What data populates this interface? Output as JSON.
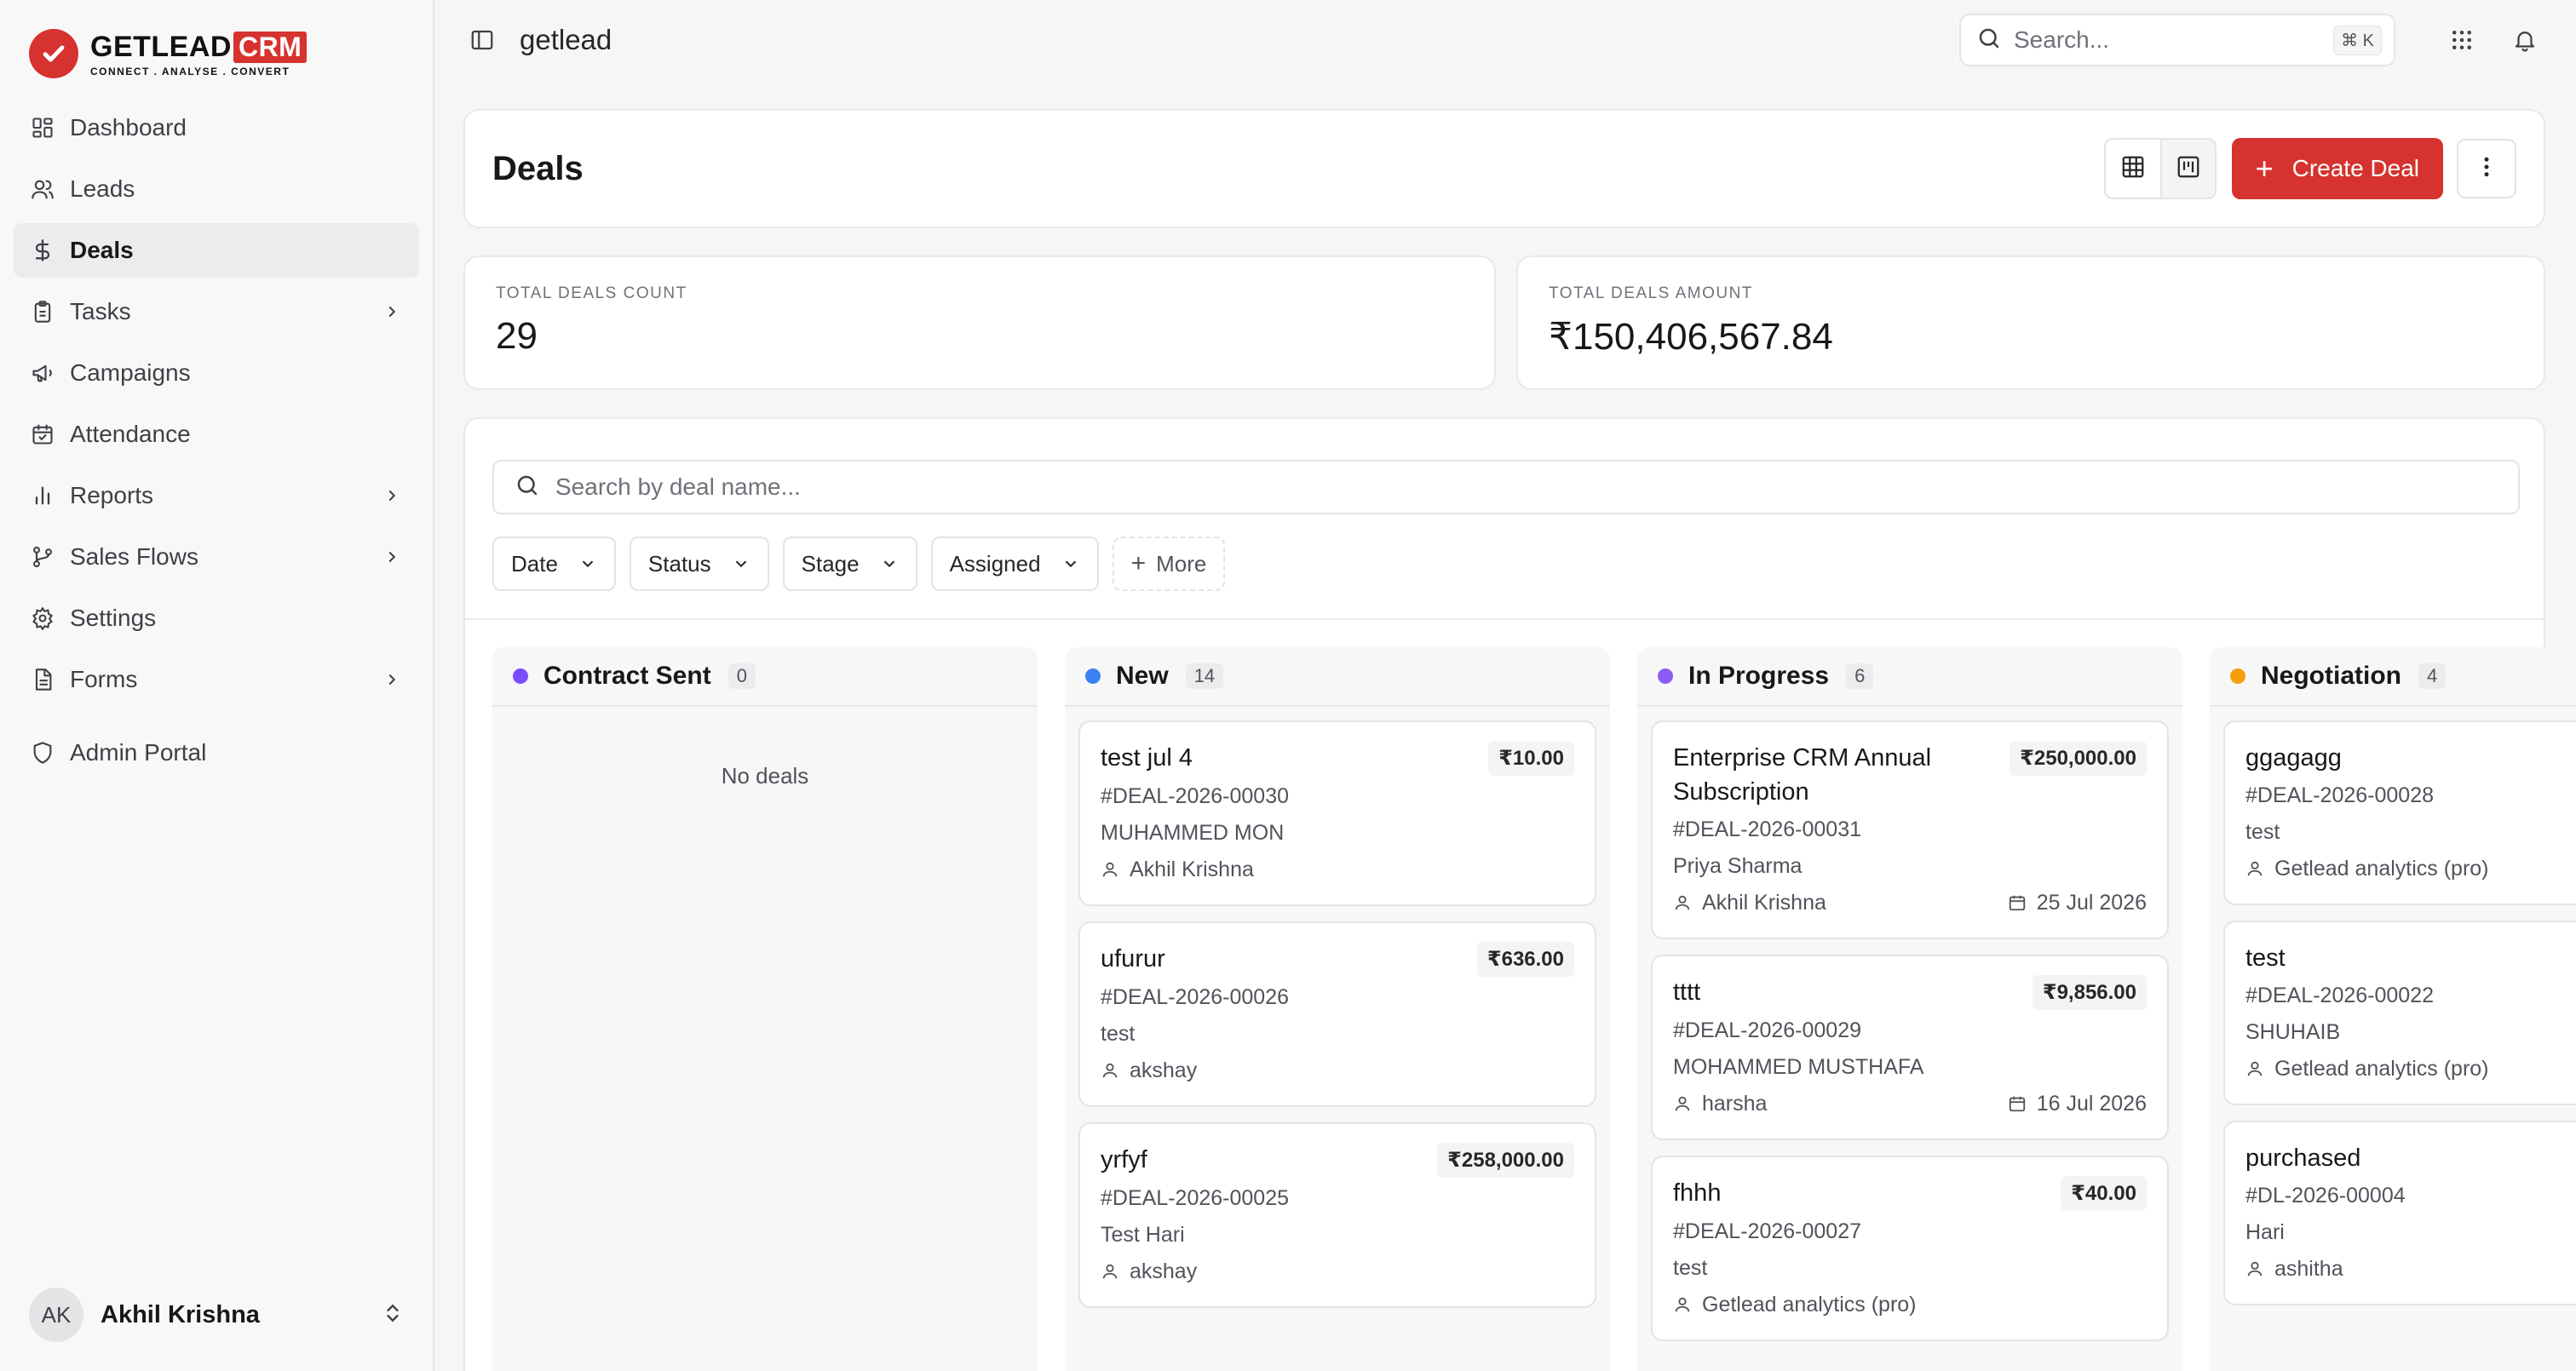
{
  "brand": {
    "name": "GETLEAD",
    "suffix": "CRM",
    "tagline": "CONNECT . ANALYSE . CONVERT"
  },
  "colors": {
    "accent": "#d6322f",
    "contract_sent": "#7c4dff",
    "new": "#3b82f6",
    "in_progress": "#8b5cf6",
    "negotiation": "#f59e0b"
  },
  "sidebar": {
    "items": [
      {
        "label": "Dashboard",
        "icon": "grid-icon"
      },
      {
        "label": "Leads",
        "icon": "users-icon"
      },
      {
        "label": "Deals",
        "icon": "dollar-icon",
        "active": true
      },
      {
        "label": "Tasks",
        "icon": "clipboard-icon",
        "has_children": true
      },
      {
        "label": "Campaigns",
        "icon": "megaphone-icon"
      },
      {
        "label": "Attendance",
        "icon": "calendar-check-icon"
      },
      {
        "label": "Reports",
        "icon": "bar-chart-icon",
        "has_children": true
      },
      {
        "label": "Sales Flows",
        "icon": "git-branch-icon",
        "has_children": true
      },
      {
        "label": "Settings",
        "icon": "gear-icon"
      },
      {
        "label": "Forms",
        "icon": "file-text-icon",
        "has_children": true
      },
      {
        "label": "Admin Portal",
        "icon": "shield-icon"
      }
    ],
    "user": {
      "initials": "AK",
      "name": "Akhil Krishna"
    }
  },
  "topbar": {
    "workspace": "getlead",
    "search_placeholder": "Search...",
    "shortcut": "⌘ K"
  },
  "page": {
    "title": "Deals",
    "create_label": "Create Deal",
    "stats": [
      {
        "label": "TOTAL DEALS COUNT",
        "value": "29"
      },
      {
        "label": "TOTAL DEALS AMOUNT",
        "value": "₹150,406,567.84"
      }
    ],
    "search_placeholder": "Search by deal name...",
    "filters": [
      "Date",
      "Status",
      "Stage",
      "Assigned"
    ],
    "more_label": "More"
  },
  "columns": [
    {
      "title": "Contract Sent",
      "count": "0",
      "empty_text": "No deals",
      "deals": []
    },
    {
      "title": "New",
      "count": "14",
      "deals": [
        {
          "name": "test jul 4",
          "amount": "₹10.00",
          "id": "#DEAL-2026-00030",
          "contact": "MUHAMMED MON",
          "owner": "Akhil Krishna"
        },
        {
          "name": "ufurur",
          "amount": "₹636.00",
          "id": "#DEAL-2026-00026",
          "contact": "test",
          "owner": "akshay"
        },
        {
          "name": "yrfyf",
          "amount": "₹258,000.00",
          "id": "#DEAL-2026-00025",
          "contact": "Test Hari",
          "owner": "akshay"
        }
      ]
    },
    {
      "title": "In Progress",
      "count": "6",
      "deals": [
        {
          "name": "Enterprise CRM Annual Subscription",
          "amount": "₹250,000.00",
          "id": "#DEAL-2026-00031",
          "contact": "Priya Sharma",
          "owner": "Akhil Krishna",
          "date": "25 Jul 2026"
        },
        {
          "name": "tttt",
          "amount": "₹9,856.00",
          "id": "#DEAL-2026-00029",
          "contact": "MOHAMMED MUSTHAFA",
          "owner": "harsha",
          "date": "16 Jul 2026"
        },
        {
          "name": "fhhh",
          "amount": "₹40.00",
          "id": "#DEAL-2026-00027",
          "contact": "test",
          "owner": "Getlead analytics (pro)"
        }
      ]
    },
    {
      "title": "Negotiation",
      "count": "4",
      "deals": [
        {
          "name": "ggagagg",
          "id": "#DEAL-2026-00028",
          "contact": "test",
          "owner": "Getlead analytics (pro)"
        },
        {
          "name": "test",
          "id": "#DEAL-2026-00022",
          "contact": "SHUHAIB",
          "owner": "Getlead analytics (pro)"
        },
        {
          "name": "purchased",
          "id": "#DL-2026-00004",
          "contact": "Hari",
          "owner": "ashitha"
        }
      ]
    }
  ]
}
